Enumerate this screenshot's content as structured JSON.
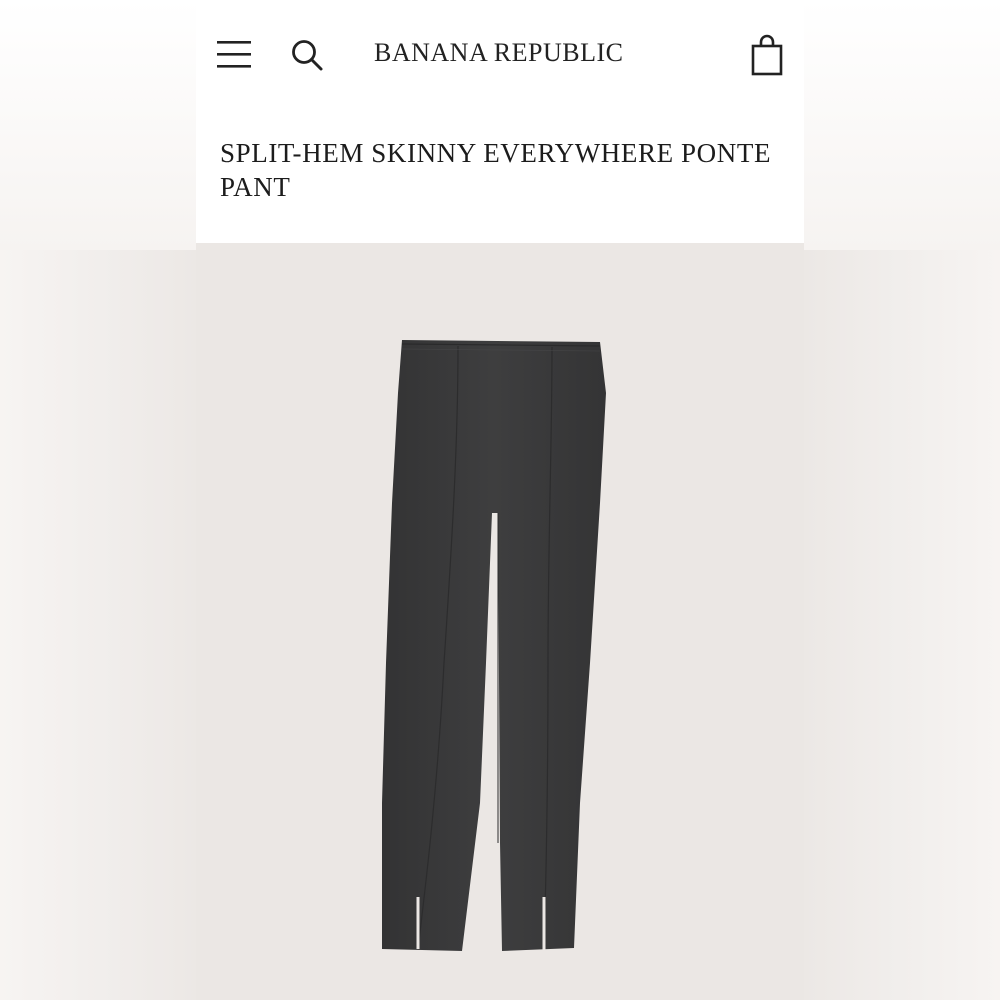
{
  "header": {
    "menu_icon": "hamburger-menu-icon",
    "search_icon": "search-icon",
    "brand": "BANANA REPUBLIC",
    "bag_icon": "shopping-bag-icon"
  },
  "product": {
    "title": "SPLIT-HEM SKINNY EVERYWHERE PONTE PANT",
    "image_alt_color": "#3a3a3b"
  },
  "colors": {
    "page_bg": "#ffffff",
    "image_bg": "#ebe7e4",
    "text": "#1c1c1c",
    "pant": "#3a3a3b"
  }
}
